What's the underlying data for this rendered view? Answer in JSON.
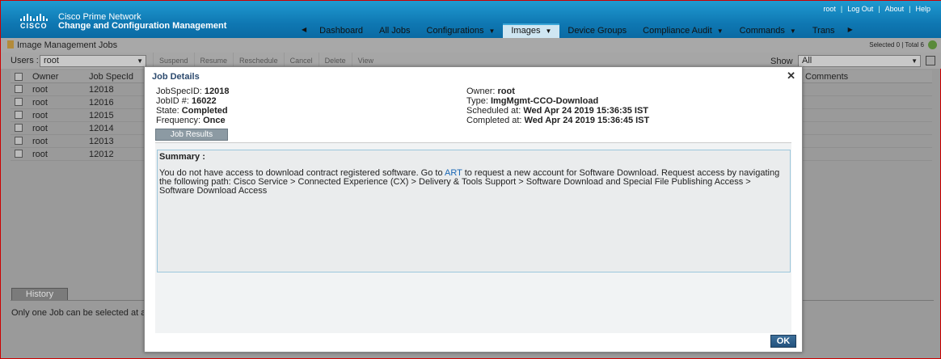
{
  "header": {
    "brand": "CISCO",
    "product_line1": "Cisco Prime Network",
    "product_line2": "Change and Configuration Management",
    "top_links": [
      "root",
      "Log Out",
      "About",
      "Help"
    ]
  },
  "nav": {
    "items": [
      "Dashboard",
      "All Jobs",
      "Configurations",
      "Images",
      "Device Groups",
      "Compliance Audit",
      "Commands",
      "Trans"
    ],
    "active": "Images"
  },
  "page": {
    "title": "Image Management Jobs",
    "counts": "Selected 0 | Total 6",
    "users_label": "Users :",
    "users_value": "root",
    "toolbar_buttons": [
      "Suspend",
      "Resume",
      "Reschedule",
      "Cancel",
      "Delete",
      "View"
    ],
    "show_label": "Show",
    "show_value": "All",
    "columns": [
      "Owner",
      "Job SpecId",
      "Comments"
    ],
    "rows": [
      {
        "owner": "root",
        "spec": "12018"
      },
      {
        "owner": "root",
        "spec": "12016"
      },
      {
        "owner": "root",
        "spec": "12015"
      },
      {
        "owner": "root",
        "spec": "12014"
      },
      {
        "owner": "root",
        "spec": "12013"
      },
      {
        "owner": "root",
        "spec": "12012"
      }
    ],
    "history_label": "History",
    "note": "Only one Job can be selected at a t"
  },
  "modal": {
    "title": "Job Details",
    "left": [
      {
        "k": "JobSpecID: ",
        "v": "12018"
      },
      {
        "k": "JobID #: ",
        "v": "16022"
      },
      {
        "k": "State: ",
        "v": "Completed"
      },
      {
        "k": "Frequency: ",
        "v": "Once"
      }
    ],
    "right": [
      {
        "k": "Owner: ",
        "v": "root"
      },
      {
        "k": "Type: ",
        "v": "ImgMgmt-CCO-Download"
      },
      {
        "k": "Scheduled at: ",
        "v": "Wed Apr 24 2019 15:36:35 IST"
      },
      {
        "k": "Completed at: ",
        "v": "Wed Apr 24 2019 15:36:45 IST"
      }
    ],
    "tab": "Job Results",
    "summary_heading": "Summary :",
    "summary_pre": "You do not have access to download contract registered software. Go to ",
    "summary_link": "ART",
    "summary_post": " to request a new account for Software Download. Request access by navigating the following path: Cisco Service > Connected Experience (CX) > Delivery & Tools Support > Software Download and Special File Publishing Access > Software Download Access",
    "ok": "OK"
  }
}
